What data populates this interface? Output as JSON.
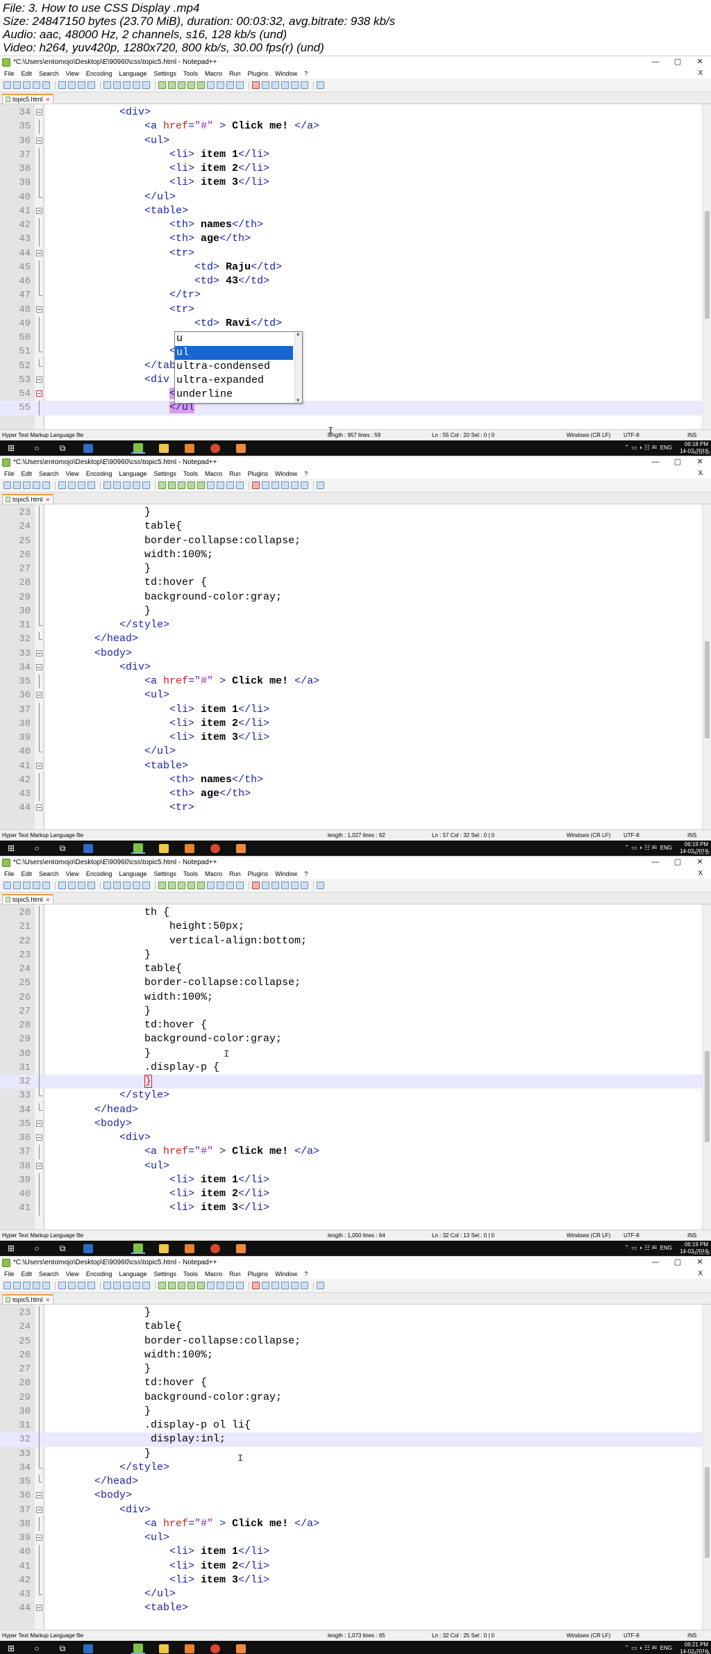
{
  "info": {
    "line1": "File: 3. How to use CSS Display .mp4",
    "line2": "Size: 24847150 bytes (23.70 MiB), duration: 00:03:32, avg.bitrate: 938 kb/s",
    "line3": "Audio: aac, 48000 Hz, 2 channels, s16, 128 kb/s (und)",
    "line4": "Video: h264, yuv420p, 1280x720, 800 kb/s, 30.00 fps(r) (und)"
  },
  "window": {
    "title": "*C:\\Users\\entomojo\\Desktop\\E\\90960\\css\\topic5.html - Notepad++",
    "controls": {
      "minimize": "—",
      "maximize": "▢",
      "close": "✕"
    },
    "menu": [
      "File",
      "Edit",
      "Search",
      "View",
      "Encoding",
      "Language",
      "Settings",
      "Tools",
      "Macro",
      "Run",
      "Plugins",
      "Window",
      "?"
    ],
    "menu_close": "X",
    "tab_label": "topic5.html",
    "status": {
      "filetype": "Hyper Text Markup Language file",
      "eol": "Windows (CR LF)",
      "encoding": "UTF-8",
      "mode": "INS"
    },
    "tray": {
      "lang": "ENG",
      "icons": "⌃  ▭  ◖ ☷  ✉"
    }
  },
  "frames": [
    {
      "status_length": "length : 957    lines : 59",
      "status_pos": "Ln : 55    Col : 20    Sel : 0 | 0",
      "time": "06:18 PM",
      "date": "14-02-2019",
      "timestamp": "00:00:50",
      "autocomplete": [
        "u",
        "ul",
        "ultra-condensed",
        "ultra-expanded",
        "underline"
      ],
      "autocomplete_selected": 1
    },
    {
      "status_length": "length : 1,027    lines : 62",
      "status_pos": "Ln : 57    Col : 32    Sel : 0 | 0",
      "time": "06:19 PM",
      "date": "14-02-2019",
      "timestamp": "00:01:32"
    },
    {
      "status_length": "length : 1,050    lines : 64",
      "status_pos": "Ln : 32    Col : 13    Sel : 0 | 0",
      "time": "06:19 PM",
      "date": "14-02-2019",
      "timestamp": "00:02:08"
    },
    {
      "status_length": "length : 1,073    lines : 65",
      "status_pos": "Ln : 32    Col : 25    Sel : 0 | 0",
      "time": "06:21 PM",
      "date": "14-02-2019",
      "timestamp": "00:02:56"
    }
  ]
}
